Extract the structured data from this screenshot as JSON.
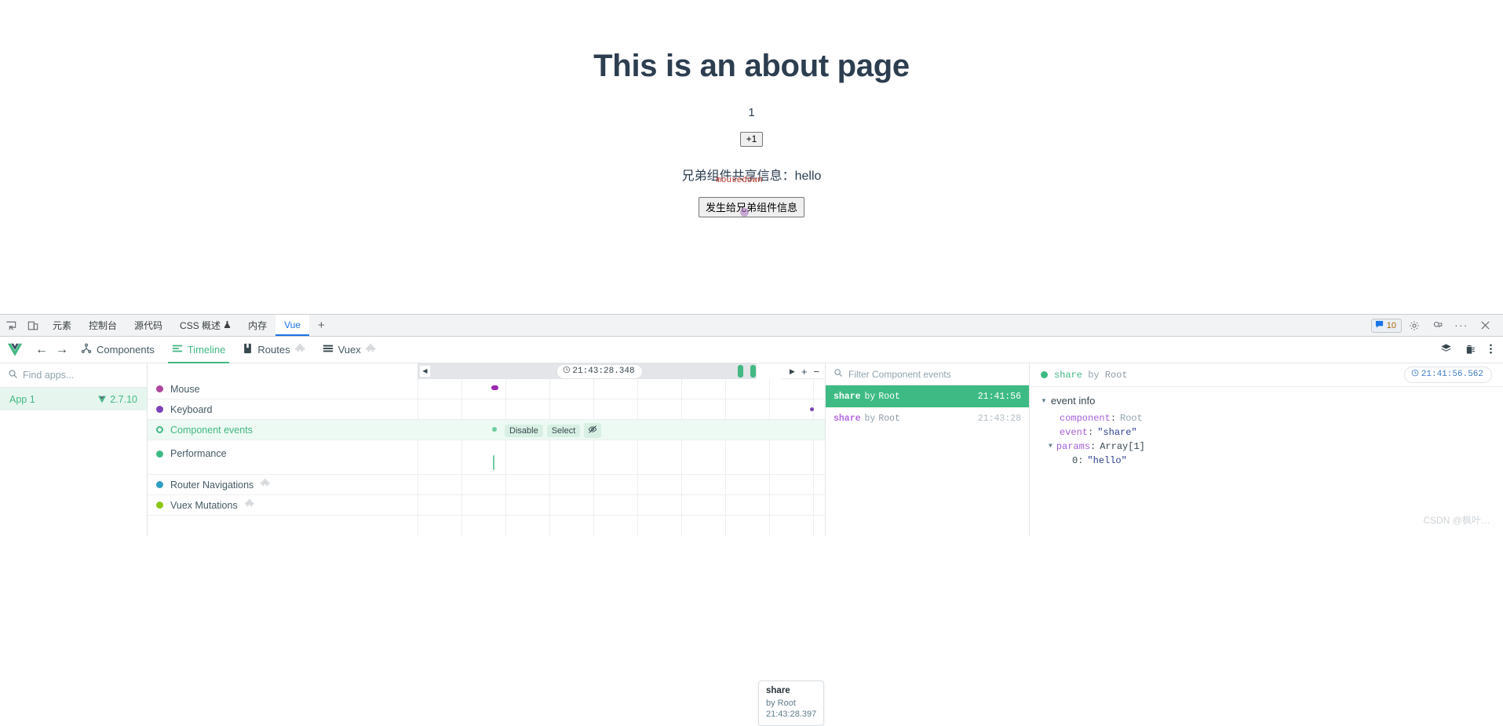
{
  "page": {
    "title": "This is an about page",
    "counter": "1",
    "increment_label": "+1",
    "share_line": "兄弟组件共享信息：hello",
    "share_button_label": "发生给兄弟组件信息",
    "mousedown_label": "mousedown"
  },
  "devtools": {
    "tabs": [
      {
        "label": "元素",
        "active": false
      },
      {
        "label": "控制台",
        "active": false
      },
      {
        "label": "源代码",
        "active": false
      },
      {
        "label": "CSS 概述",
        "active": false,
        "flask": true
      },
      {
        "label": "内存",
        "active": false
      },
      {
        "label": "Vue",
        "active": true
      }
    ],
    "add_tab_label": "+",
    "message_count": "10"
  },
  "vue_nav": {
    "items": [
      {
        "label": "Components",
        "active": false,
        "puzzle": false
      },
      {
        "label": "Timeline",
        "active": true,
        "puzzle": false
      },
      {
        "label": "Routes",
        "active": false,
        "puzzle": true
      },
      {
        "label": "Vuex",
        "active": false,
        "puzzle": true
      }
    ]
  },
  "apps": {
    "search_placeholder": "Find apps...",
    "selected": {
      "name": "App 1",
      "version": "2.7.10"
    }
  },
  "timeline": {
    "current_time": "21:43:28.348",
    "zoom_in_label": "+",
    "zoom_out_label": "−",
    "layers": [
      {
        "label": "Mouse",
        "color": "#b0479e",
        "ring": false,
        "plugin": false,
        "active": false,
        "tall": false
      },
      {
        "label": "Keyboard",
        "color": "#7d41b8",
        "ring": false,
        "plugin": false,
        "active": false,
        "tall": false
      },
      {
        "label": "Component events",
        "color": "#42b883",
        "ring": true,
        "plugin": false,
        "active": true,
        "tall": false
      },
      {
        "label": "Performance",
        "color": "#3ebb84",
        "ring": false,
        "plugin": false,
        "active": false,
        "tall": true
      },
      {
        "label": "Router Navigations",
        "color": "#2f9ec4",
        "ring": false,
        "plugin": true,
        "active": false,
        "tall": false
      },
      {
        "label": "Vuex Mutations",
        "color": "#8bc716",
        "ring": false,
        "plugin": true,
        "active": false,
        "tall": false
      }
    ],
    "row_actions": {
      "disable": "Disable",
      "select": "Select"
    },
    "tooltip": {
      "name": "share",
      "by": "by Root",
      "time": "21:43:28.397"
    }
  },
  "events_list": {
    "filter_placeholder": "Filter Component events",
    "rows": [
      {
        "name": "share",
        "by": "by",
        "component": "Root",
        "time": "21:41:56",
        "selected": true
      },
      {
        "name": "share",
        "by": "by",
        "component": "Root",
        "time": "21:43:28",
        "selected": false
      }
    ]
  },
  "inspector": {
    "event_name": "share",
    "event_by": "by",
    "event_component": "Root",
    "timestamp": "21:41:56.562",
    "section_label": "event info",
    "fields": [
      {
        "key": "component",
        "value": "Root",
        "kind": "plain",
        "depth": 1,
        "caret": false
      },
      {
        "key": "event",
        "value": "\"share\"",
        "kind": "string",
        "depth": 1,
        "caret": false
      },
      {
        "key": "params",
        "value": "Array[1]",
        "kind": "plain",
        "depth": 0,
        "caret": true
      },
      {
        "key": "0",
        "value": "\"hello\"",
        "kind": "string",
        "depth": 2,
        "caret": false
      }
    ],
    "watermark": "CSDN @枫叶…"
  }
}
